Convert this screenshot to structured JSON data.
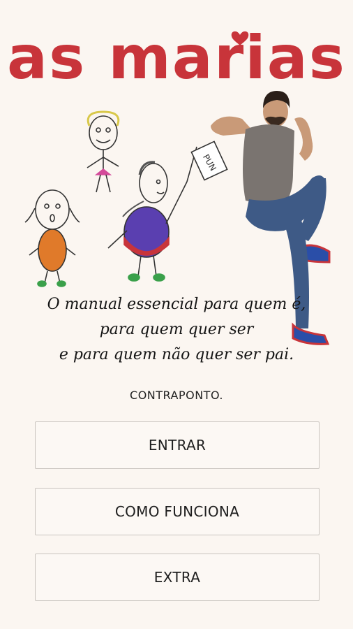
{
  "app": {
    "title": "as marias"
  },
  "tagline": {
    "line1": "O manual essencial para quem é,",
    "line2": "para quem quer ser",
    "line3": "e para quem não quer ser pai."
  },
  "publisher": {
    "name": "CONTRAPONTO."
  },
  "illustration": {
    "sign_text": "PUN"
  },
  "buttons": {
    "enter": "ENTRAR",
    "how_it_works": "COMO FUNCIONA",
    "extra": "EXTRA"
  },
  "colors": {
    "background": "#fbf6f1",
    "title_red": "#c8343a",
    "button_border": "#c9c4bf"
  }
}
